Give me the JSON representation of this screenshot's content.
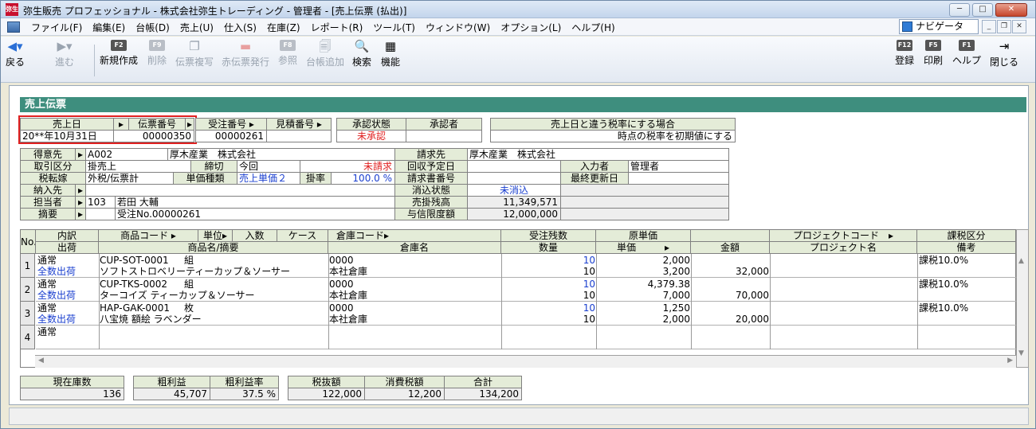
{
  "window": {
    "title": "弥生販売 プロフェッショナル - 株式会社弥生トレーディング - 管理者 - [売上伝票 (払出)]",
    "app_icon": "弥生"
  },
  "menu": [
    "ファイル(F)",
    "編集(E)",
    "台帳(D)",
    "売上(U)",
    "仕入(S)",
    "在庫(Z)",
    "レポート(R)",
    "ツール(T)",
    "ウィンドウ(W)",
    "オプション(L)",
    "ヘルプ(H)"
  ],
  "navigator": "ナビゲータ",
  "toolbar": {
    "back": "戻る",
    "forward": "進む",
    "new": "新規作成",
    "delete": "削除",
    "copy": "伝票複写",
    "red": "赤伝票発行",
    "ref": "参照",
    "ledger_add": "台帳追加",
    "search": "検索",
    "function": "機能",
    "save": "登録",
    "print": "印刷",
    "help": "ヘルプ",
    "close": "閉じる",
    "keys": {
      "new": "F2",
      "delete": "F9",
      "ref": "F8",
      "save": "F12",
      "print": "F5",
      "help": "F1"
    }
  },
  "form_title": "売上伝票",
  "header": {
    "sales_date_label": "売上日",
    "sales_date": "20**年10月31日",
    "slip_no_label": "伝票番号",
    "slip_no": "00000350",
    "order_no_label": "受注番号",
    "order_no": "00000261",
    "estimate_no_label": "見積番号",
    "estimate_no": "",
    "approval_status_label": "承認状態",
    "approval_status": "未承認",
    "approver_label": "承認者",
    "approver": "",
    "tax_rate_label": "売上日と違う税率にする場合",
    "tax_rate_value": "時点の税率を初期値にする"
  },
  "customer": {
    "customer_label": "得意先",
    "customer_code": "A002",
    "customer_name": "厚木産業　株式会社",
    "deal_type_label": "取引区分",
    "deal_type": "掛売上",
    "cutoff_label": "締切",
    "cutoff": "今回",
    "unbilled": "未請求",
    "tax_transfer_label": "税転嫁",
    "tax_transfer": "外税/伝票計",
    "price_type_label": "単価種類",
    "price_type": "売上単価２",
    "rate_label": "掛率",
    "rate": "100.0 %",
    "delivery_label": "納入先",
    "delivery": "",
    "person_label": "担当者",
    "person_code": "103",
    "person_name": "若田 大輔",
    "memo_label": "摘要",
    "memo": "受注No.00000261",
    "bill_to_label": "請求先",
    "bill_to": "厚木産業　株式会社",
    "collection_label": "回収予定日",
    "collection": "",
    "invoice_no_label": "請求書番号",
    "invoice_no": "",
    "clearing_label": "消込状態",
    "clearing": "未消込",
    "receivable_label": "売掛残高",
    "receivable": "11,349,571",
    "credit_label": "与信限度額",
    "credit": "12,000,000",
    "entered_by_label": "入力者",
    "entered_by": "管理者",
    "last_updated_label": "最終更新日",
    "last_updated": ""
  },
  "grid": {
    "headers": {
      "no": "No.",
      "detail": "内訳",
      "ship": "出荷",
      "item_code": "商品コード",
      "unit": "単位",
      "qty_in": "入数",
      "case": "ケース",
      "wh_code": "倉庫コード",
      "item_name": "商品名/摘要",
      "wh_name": "倉庫名",
      "order_remain": "受注残数",
      "qty": "数量",
      "cost": "原単価",
      "price": "単価",
      "amount": "金額",
      "project_code": "プロジェクトコード",
      "project_name": "プロジェクト名",
      "tax_type": "課税区分",
      "note": "備考"
    },
    "rows": [
      {
        "no": "1",
        "detail": "通常",
        "ship": "全数出荷",
        "code": "CUP-SOT-0001",
        "unit": "組",
        "name": "ソフトストロベリーティーカップ＆ソーサー",
        "wh_code": "0000",
        "wh_name": "本社倉庫",
        "order_remain": "10",
        "qty": "10",
        "cost": "2,000",
        "price": "3,200",
        "amount": "32,000",
        "tax": "課税10.0%"
      },
      {
        "no": "2",
        "detail": "通常",
        "ship": "全数出荷",
        "code": "CUP-TKS-0002",
        "unit": "組",
        "name": "ターコイズ ティーカップ＆ソーサー",
        "wh_code": "0000",
        "wh_name": "本社倉庫",
        "order_remain": "10",
        "qty": "10",
        "cost": "4,379.38",
        "price": "7,000",
        "amount": "70,000",
        "tax": "課税10.0%"
      },
      {
        "no": "3",
        "detail": "通常",
        "ship": "全数出荷",
        "code": "HAP-GAK-0001",
        "unit": "枚",
        "name": "八宝焼 額絵 ラベンダー",
        "wh_code": "0000",
        "wh_name": "本社倉庫",
        "order_remain": "10",
        "qty": "10",
        "cost": "1,250",
        "price": "2,000",
        "amount": "20,000",
        "tax": "課税10.0%"
      },
      {
        "no": "4",
        "detail": "通常",
        "ship": "",
        "code": "",
        "unit": "",
        "name": "",
        "wh_code": "",
        "wh_name": "",
        "order_remain": "",
        "qty": "",
        "cost": "",
        "price": "",
        "amount": "",
        "tax": ""
      }
    ]
  },
  "totals": {
    "stock_label": "現在庫数",
    "stock": "136",
    "gross_label": "粗利益",
    "gross": "45,707",
    "gross_rate_label": "粗利益率",
    "gross_rate": "37.5 %",
    "pretax_label": "税抜額",
    "pretax": "122,000",
    "tax_label": "消費税額",
    "tax": "12,200",
    "total_label": "合計",
    "total": "134,200"
  }
}
